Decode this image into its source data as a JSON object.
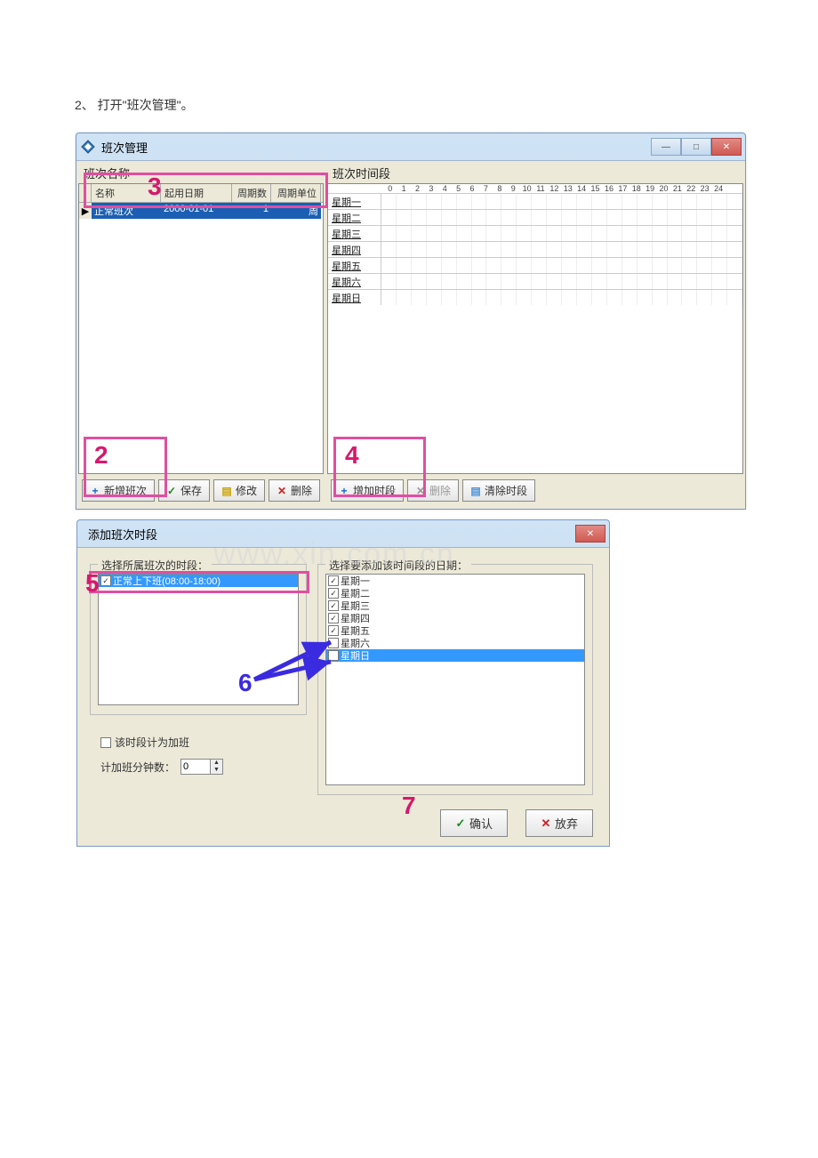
{
  "instruction": "2、 打开\"班次管理\"。",
  "window1": {
    "title": "班次管理",
    "left_label": "班次名称",
    "right_label": "班次时间段",
    "table": {
      "headers": {
        "name": "名称",
        "date": "起用日期",
        "cycle": "周期数",
        "unit": "周期单位"
      },
      "row": {
        "name": "正常班次",
        "date": "2000-01-01",
        "cycle": "1",
        "unit": "周"
      }
    },
    "hours": [
      "0",
      "1",
      "2",
      "3",
      "4",
      "5",
      "6",
      "7",
      "8",
      "9",
      "10",
      "11",
      "12",
      "13",
      "14",
      "15",
      "16",
      "17",
      "18",
      "19",
      "20",
      "21",
      "22",
      "23",
      "24"
    ],
    "days": [
      "星期一",
      "星期二",
      "星期三",
      "星期四",
      "星期五",
      "星期六",
      "星期日"
    ],
    "toolbar_left": {
      "add": "新增班次",
      "save": "保存",
      "edit": "修改",
      "delete": "删除"
    },
    "toolbar_right": {
      "add": "增加时段",
      "delete": "删除",
      "clear": "清除时段"
    }
  },
  "window2": {
    "title": "添加班次时段",
    "left_label": "选择所属班次的时段：",
    "right_label": "选择要添加该时间段的日期：",
    "shift_option": "正常上下班(08:00-18:00)",
    "days": [
      {
        "label": "星期一",
        "checked": true
      },
      {
        "label": "星期二",
        "checked": true
      },
      {
        "label": "星期三",
        "checked": true
      },
      {
        "label": "星期四",
        "checked": true
      },
      {
        "label": "星期五",
        "checked": true
      },
      {
        "label": "星期六",
        "checked": false
      },
      {
        "label": "星期日",
        "checked": false
      }
    ],
    "overtime_label": "该时段计为加班",
    "minutes_label": "计加班分钟数：",
    "minutes_value": "0",
    "confirm": "确认",
    "cancel": "放弃"
  },
  "annotations": {
    "a2": "2",
    "a3": "3",
    "a4": "4",
    "a5": "5",
    "a6": "6",
    "a7": "7"
  },
  "watermark": "www.xin.com.cn"
}
